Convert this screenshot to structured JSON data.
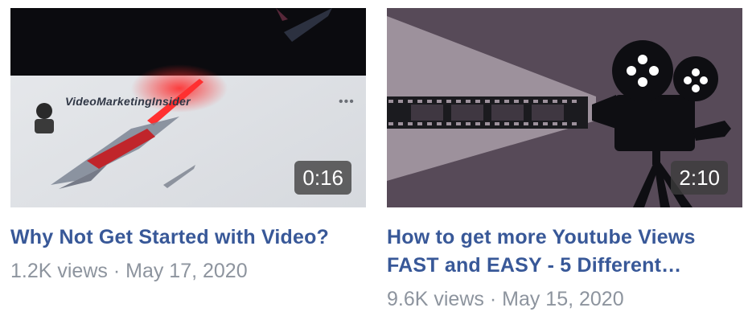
{
  "videos": [
    {
      "title": "Why Not Get Started with Video?",
      "views": "1.2K views",
      "separator": "·",
      "date": "May 17, 2020",
      "duration": "0:16",
      "channel_text": "VideoMarketingInsider",
      "more_glyph": "•••"
    },
    {
      "title": "How to get more Youtube Views FAST and EASY - 5 Different…",
      "views": "9.6K views",
      "separator": "·",
      "date": "May 15, 2020",
      "duration": "2:10"
    }
  ],
  "colors": {
    "title_link": "#385898",
    "meta_text": "#8d949e",
    "duration_bg": "#3c3c3c",
    "projector_bg": "#574a58"
  },
  "icons": [
    "film-projector-icon",
    "avatar",
    "more-options-icon"
  ]
}
